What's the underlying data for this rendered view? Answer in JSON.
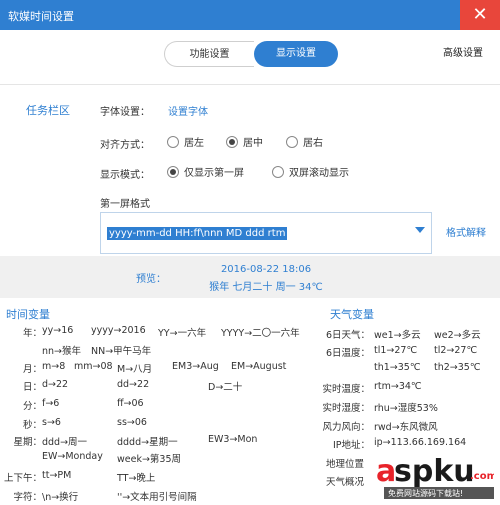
{
  "window": {
    "title": "软媒时间设置",
    "close_glyph": "✕"
  },
  "tabs": {
    "function": "功能设置",
    "display": "显示设置",
    "advanced": "高级设置"
  },
  "sidebar": {
    "taskbar": "任务栏区"
  },
  "font": {
    "label": "字体设置：",
    "link": "设置字体"
  },
  "align": {
    "label": "对齐方式：",
    "options": [
      "居左",
      "居中",
      "居右"
    ],
    "selected": "居中"
  },
  "display_mode": {
    "label": "显示模式：",
    "options": [
      "仅显示第一屏",
      "双屏滚动显示"
    ],
    "selected": "仅显示第一屏"
  },
  "first_screen": {
    "label": "第一屏格式",
    "value": "yyyy-mm-dd HH:ff\\nnn MD ddd rtm",
    "help": "格式解释"
  },
  "preview": {
    "label": "预览：",
    "line1": "2016-08-22 18:06",
    "line2": "猴年 七月二十 周一 34℃"
  },
  "time_vars": {
    "title": "时间变量",
    "year": {
      "key": "年：",
      "items": [
        "yy→16",
        "yyyy→2016",
        "YY→一六年",
        "YYYY→二〇一六年",
        "nn→猴年",
        "NN→甲午马年"
      ]
    },
    "month": {
      "key": "月：",
      "items": [
        "m→8",
        "mm→08",
        "M→八月",
        "EM3→Aug",
        "EM→August"
      ]
    },
    "day": {
      "key": "日：",
      "items": [
        "d→22",
        "dd→22",
        "D→二十"
      ]
    },
    "minute": {
      "key": "分：",
      "items": [
        "f→6",
        "ff→06"
      ]
    },
    "second": {
      "key": "秒：",
      "items": [
        "s→6",
        "ss→06"
      ]
    },
    "week": {
      "key": "星期：",
      "items": [
        "ddd→周一",
        "dddd→星期一",
        "EW3→Mon",
        "EW→Monday",
        "week→第35周"
      ]
    },
    "ampm": {
      "key": "上下午：",
      "items": [
        "tt→PM",
        "TT→晚上"
      ]
    },
    "char": {
      "key": "字符：",
      "items": [
        "\\n→换行",
        "''→文本用引号间隔"
      ]
    }
  },
  "weather_vars": {
    "title": "天气变量",
    "six_day_weather": {
      "key": "6日天气：",
      "items": [
        "we1→多云",
        "we2→多云"
      ]
    },
    "six_day_temp": {
      "key": "6日温度：",
      "items": [
        "tl1→27℃",
        "tl2→27℃",
        "th1→35℃",
        "th2→35℃"
      ]
    },
    "real_temp": {
      "key": "实时温度：",
      "items": [
        "rtm→34℃"
      ]
    },
    "real_humidity": {
      "key": "实时湿度：",
      "items": [
        "rhu→湿度53%"
      ]
    },
    "wind": {
      "key": "风力风向：",
      "items": [
        "rwd→东风微风"
      ]
    },
    "ip": {
      "key": "IP地址：",
      "items": [
        "ip→113.66.169.164"
      ]
    },
    "more": [
      "地理位置",
      "天气概况"
    ]
  },
  "watermark": {
    "text": "aspku",
    "suffix": ".com",
    "sub": "免费网站源码下载站!",
    "colors": {
      "a": "#e8232a",
      "s": "#1a1a1a",
      "com": "#e8232a"
    }
  },
  "colors": {
    "accent": "#2f7fd1",
    "close": "#e8463b",
    "panel": "#f0f0f0"
  }
}
